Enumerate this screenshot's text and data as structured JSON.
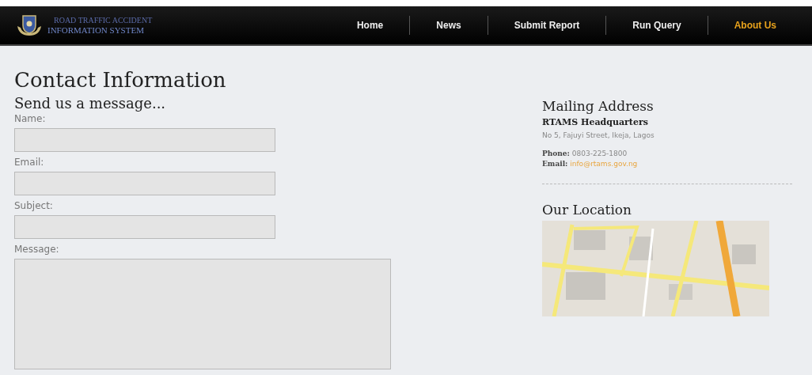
{
  "logo": {
    "line_1": "ROAD TRAFFIC ACCIDENT",
    "line_2": "INFORMATION SYSTEM"
  },
  "nav": [
    {
      "label": "Home",
      "selected": false
    },
    {
      "label": "News",
      "selected": false
    },
    {
      "label": "Submit Report",
      "selected": false
    },
    {
      "label": "Run Query",
      "selected": false
    },
    {
      "label": "About Us",
      "selected": true
    }
  ],
  "page_title": "Contact Information",
  "form": {
    "heading": "Send us a message...",
    "fields": [
      {
        "label": "Name:",
        "kind": "input"
      },
      {
        "label": "Email:",
        "kind": "input"
      },
      {
        "label": "Subject:",
        "kind": "input"
      },
      {
        "label": "Message:",
        "kind": "textarea"
      }
    ]
  },
  "mailing": {
    "heading": "Mailing Address",
    "org": "RTAMS Headquarters",
    "address": "No 5, Fajuyi Street, Ikeja, Lagos",
    "phone_label": "Phone:",
    "phone": "0803-225-1800",
    "email_label": "Email:",
    "email": "info@rtams.gov.ng"
  },
  "location": {
    "heading": "Our Location"
  }
}
